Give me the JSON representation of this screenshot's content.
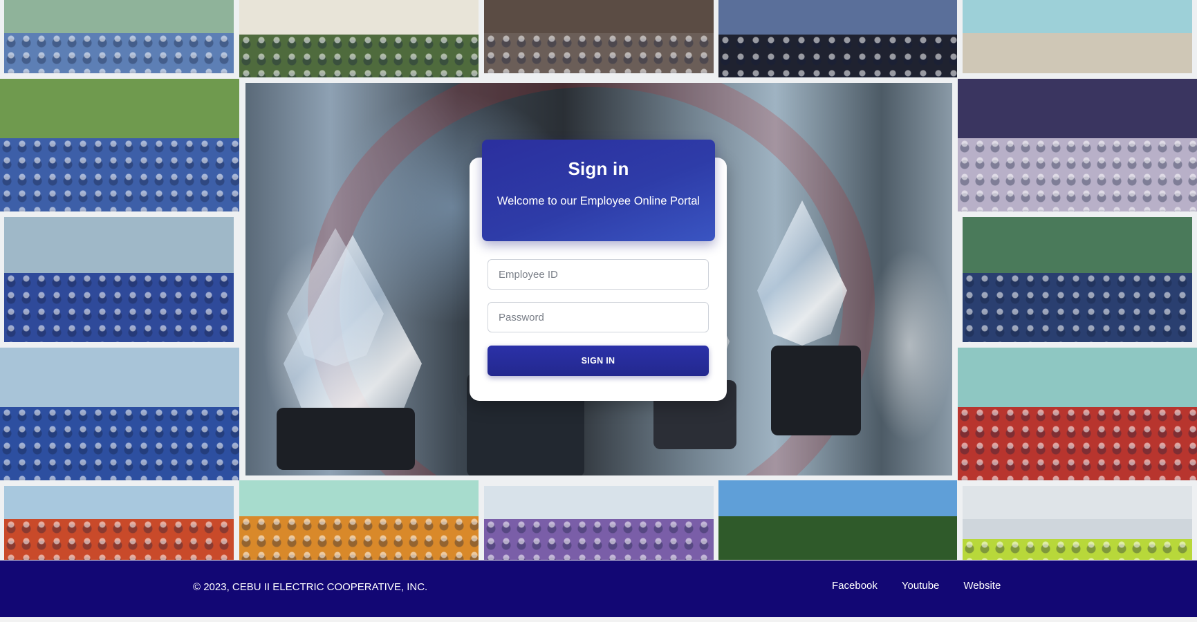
{
  "signin": {
    "title": "Sign in",
    "subtitle": "Welcome to our Employee Online Portal",
    "employee_id_placeholder": "Employee ID",
    "password_placeholder": "Password",
    "button_label": "SIGN IN"
  },
  "footer": {
    "copyright": "© 2023, CEBU II ELECTRIC COOPERATIVE, INC.",
    "links": [
      "Facebook",
      "Youtube",
      "Website"
    ]
  },
  "colors": {
    "primary": "#2b31a8",
    "footer_bg": "#120774"
  }
}
